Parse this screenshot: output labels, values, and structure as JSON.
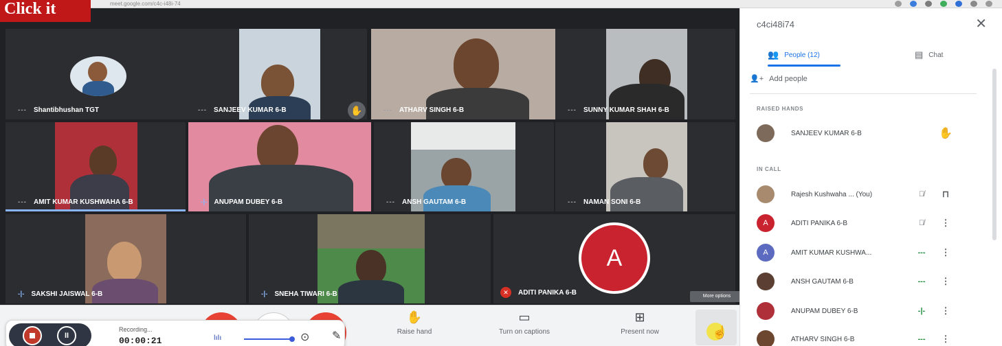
{
  "banner": {
    "label": "Click it"
  },
  "browser": {
    "url": "meet.google.com/c4c-i48i-74"
  },
  "tiles": [
    {
      "name": "Shantibhushan TGT",
      "mic": "---"
    },
    {
      "name": "SANJEEV KUMAR 6-B",
      "mic": "---"
    },
    {
      "name": "ATHARV SINGH 6-B",
      "mic": "---"
    },
    {
      "name": "SUNNY KUMAR SHAH 6-B",
      "mic": "---"
    },
    {
      "name": "AMIT KUMAR KUSHWAHA 6-B",
      "mic": "---"
    },
    {
      "name": "ANUPAM DUBEY 6-B",
      "mic": "-|-"
    },
    {
      "name": "ANSH GAUTAM 6-B",
      "mic": "---"
    },
    {
      "name": "NAMAN SONI 6-B",
      "mic": "---"
    },
    {
      "name": "SAKSHI JAISWAL 6-B",
      "mic": "-|-"
    },
    {
      "name": "SNEHA TIWARI 6-B",
      "mic": "-|-"
    },
    {
      "name": "ADITI PANIKA 6-B",
      "avatar_letter": "A"
    }
  ],
  "controls": {
    "raise_hand": "Raise hand",
    "captions": "Turn on captions",
    "present": "Present now",
    "more_tooltip": "More options"
  },
  "recorder": {
    "status": "Recording...",
    "time": "00:00:21",
    "pause_symbol": "II",
    "bars_symbol": "lılı"
  },
  "panel": {
    "meeting_code": "c4ci48i74",
    "tabs": {
      "people": "People (12)",
      "chat": "Chat"
    },
    "add_people": "Add people",
    "raised_hands_header": "RAISED HANDS",
    "in_call_header": "IN CALL",
    "raised": [
      {
        "name": "SANJEEV KUMAR 6-B"
      }
    ],
    "in_call": [
      {
        "name": "Rajesh Kushwaha ... (You)",
        "avatar": "",
        "status": "mute"
      },
      {
        "name": "ADITI PANIKA 6-B",
        "avatar": "A",
        "status": "mute"
      },
      {
        "name": "AMIT KUMAR KUSHWA...",
        "avatar": "A",
        "status": "---"
      },
      {
        "name": "ANSH GAUTAM 6-B",
        "avatar": "",
        "status": "---"
      },
      {
        "name": "ANUPAM DUBEY 6-B",
        "avatar": "",
        "status": "-|-"
      },
      {
        "name": "ATHARV SINGH 6-B",
        "avatar": "",
        "status": "---"
      }
    ]
  },
  "colors": {
    "accent": "#1a73e8",
    "record_red": "#c0392b",
    "avatar_red": "#c9232f",
    "avatar_purple": "#5c6bc0",
    "stage_bg": "#1f2125"
  }
}
